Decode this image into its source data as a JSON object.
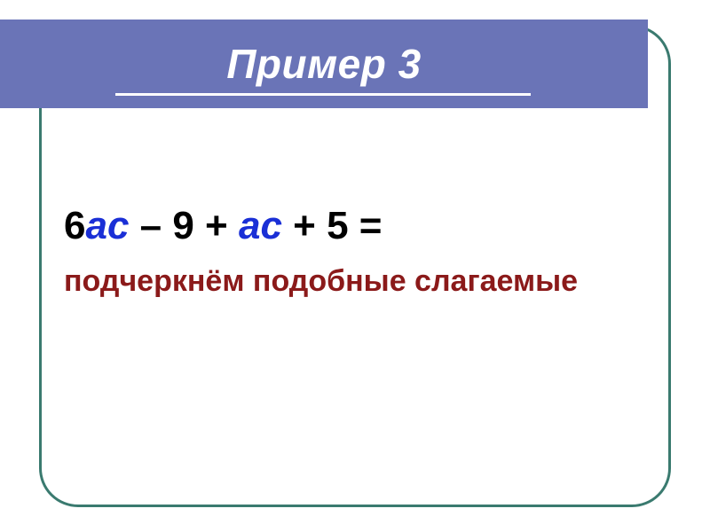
{
  "title": "Пример 3",
  "equation": {
    "part1": "6",
    "var1": "ас",
    "part2": " – 9 + ",
    "var2": "ас",
    "part3": " + 5 ="
  },
  "subtitle": "подчеркнём подобные слагаемые"
}
